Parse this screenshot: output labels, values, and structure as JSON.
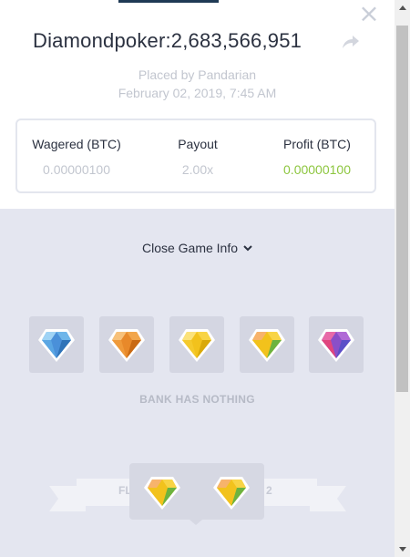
{
  "header": {
    "close_icon": "×",
    "title": "Diamondpoker:2,683,566,951",
    "placed_by": "Placed by Pandarian",
    "date": "February 02, 2019, 7:45 AM"
  },
  "stats": {
    "wagered_label": "Wagered (BTC)",
    "wagered_value": "0.00000100",
    "payout_label": "Payout",
    "payout_value": "2.00x",
    "profit_label": "Profit (BTC)",
    "profit_value": "0.00000100",
    "profit_color": "#8dc63f"
  },
  "game": {
    "toggle_label": "Close Game Info",
    "bank_gems": [
      "blue-gem",
      "orange-gem",
      "yellow-gem",
      "yellow-green-gem",
      "purple-gem"
    ],
    "bank_text": "BANK HAS NOTHING",
    "ribbon_left": "FL",
    "ribbon_right": "2",
    "player_gems": [
      "yellow-green-gem",
      "yellow-green-gem"
    ]
  }
}
